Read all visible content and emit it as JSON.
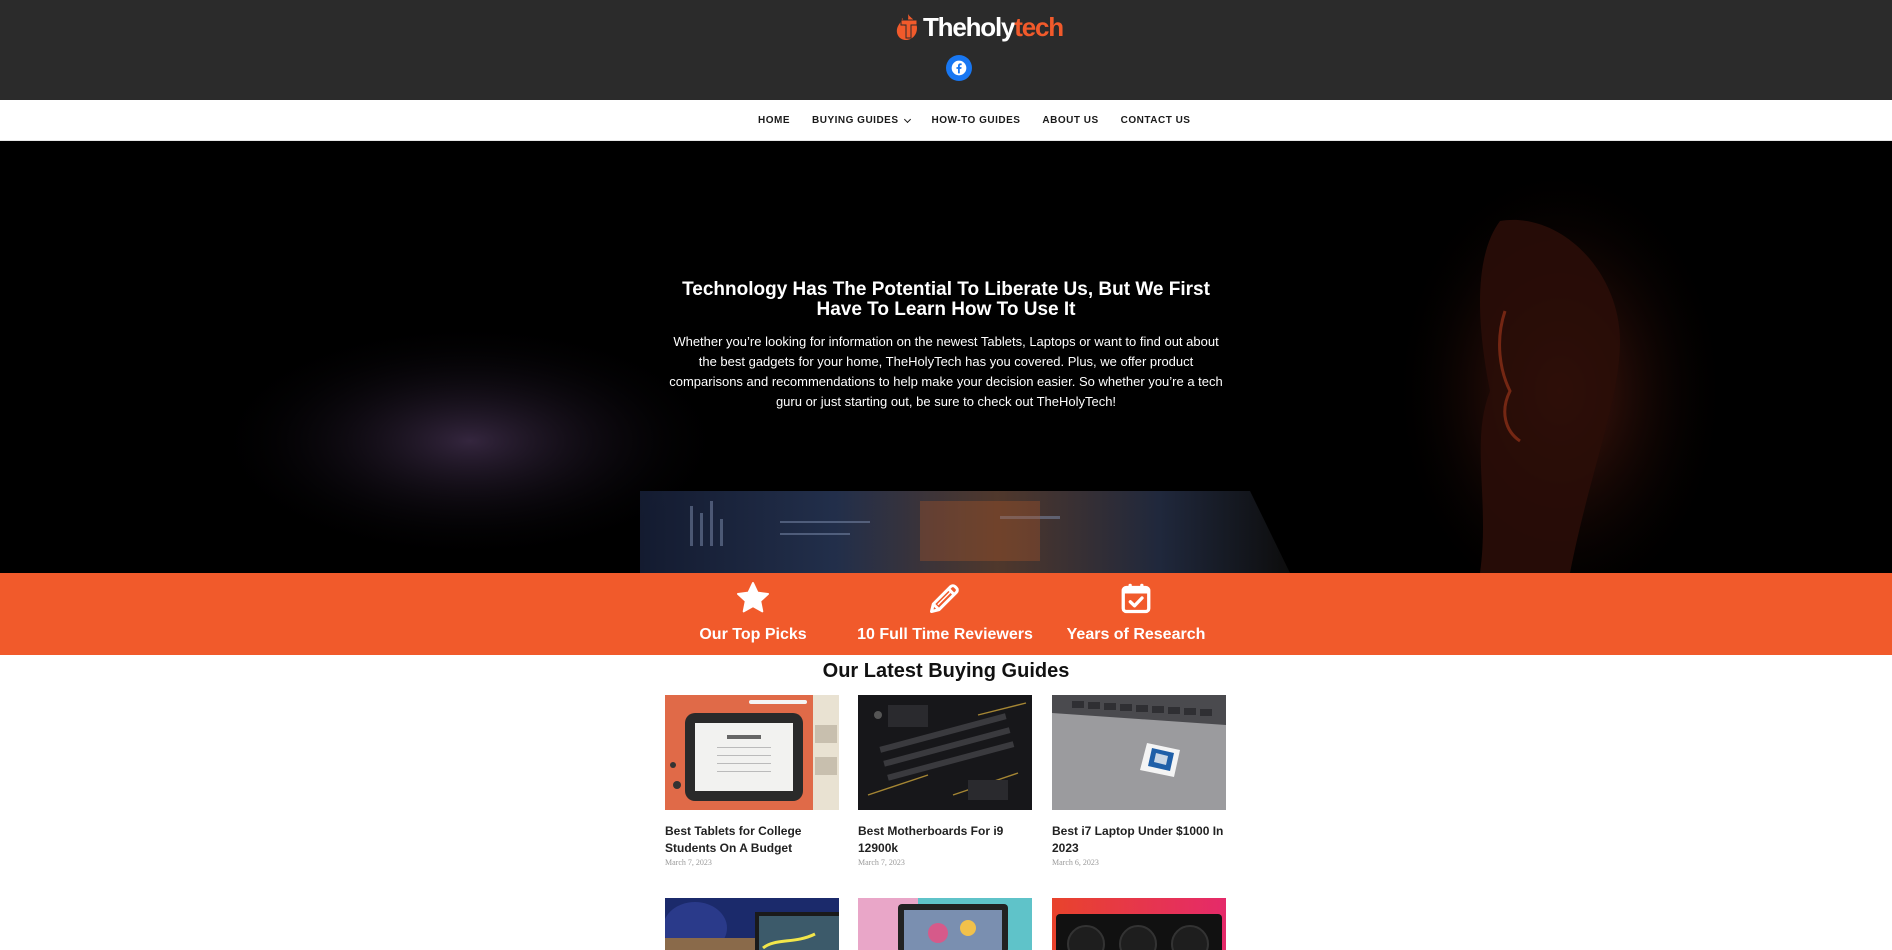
{
  "header": {
    "logo_text_a": "Theholy",
    "logo_text_b": "tech",
    "brand_color": "#f15a2b",
    "social": [
      {
        "name": "facebook",
        "icon": "facebook-icon",
        "color": "#1877f2"
      }
    ]
  },
  "nav": {
    "items": [
      {
        "label": "HOME"
      },
      {
        "label": "BUYING GUIDES",
        "has_dropdown": true
      },
      {
        "label": "HOW-TO GUIDES"
      },
      {
        "label": "ABOUT US"
      },
      {
        "label": "CONTACT US"
      }
    ]
  },
  "hero": {
    "title": "Technology Has The Potential To Liberate Us, But We First Have To Learn How To Use It",
    "text": "Whether you’re looking for information on the newest Tablets, Laptops or want to find out about the best gadgets for your home, TheHolyTech has you covered. Plus, we offer product comparisons and recommendations to help make your decision easier. So whether you’re a tech guru or just starting out, be sure to check out TheHolyTech!"
  },
  "features": [
    {
      "icon": "star-icon",
      "label": "Our Top Picks"
    },
    {
      "icon": "pencil-icon",
      "label": "10 Full Time Reviewers"
    },
    {
      "icon": "calendar-check-icon",
      "label": "Years of Research"
    }
  ],
  "guides": {
    "heading": "Our Latest Buying Guides",
    "posts": [
      {
        "title": "Best Tablets for College Students On A Budget",
        "date": "March 7, 2023"
      },
      {
        "title": "Best Motherboards For i9 12900k",
        "date": "March 7, 2023"
      },
      {
        "title": "Best i7 Laptop Under $1000 In 2023",
        "date": "March 6, 2023"
      }
    ],
    "preview_row_count": 3
  }
}
